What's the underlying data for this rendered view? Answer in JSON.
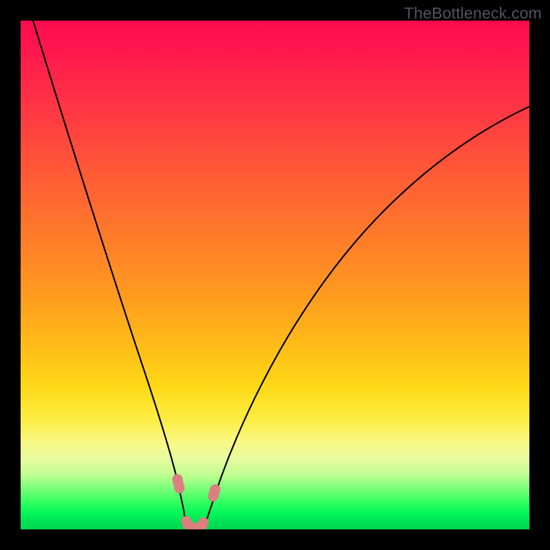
{
  "watermark": "TheBottleneck.com",
  "chart_data": {
    "type": "line",
    "title": "",
    "xlabel": "",
    "ylabel": "",
    "xlim": [
      0,
      100
    ],
    "ylim": [
      0,
      100
    ],
    "background_gradient": {
      "top": "#ff0b4f",
      "bottom": "#00d851",
      "meaning": "red (high bottleneck) to green (low bottleneck)"
    },
    "series": [
      {
        "name": "bottleneck-curve",
        "description": "V-shaped bottleneck percentage curve; minimum near optimal match point",
        "x": [
          0,
          3,
          6,
          9,
          12,
          15,
          18,
          20,
          22,
          24,
          26,
          28,
          30,
          31,
          32,
          33,
          34,
          36,
          38,
          41,
          45,
          50,
          56,
          63,
          72,
          82,
          93,
          100
        ],
        "y": [
          100,
          92,
          84,
          76,
          68,
          60,
          52,
          46,
          40,
          33,
          25,
          17,
          8,
          4,
          1,
          0,
          1,
          5,
          11,
          19,
          28,
          37,
          46,
          55,
          64,
          72,
          79,
          83
        ]
      }
    ],
    "optimal_range": {
      "x_start": 30,
      "x_end": 35,
      "y_min": 0,
      "y_max": 8,
      "marker_color": "#db7f7f"
    }
  }
}
